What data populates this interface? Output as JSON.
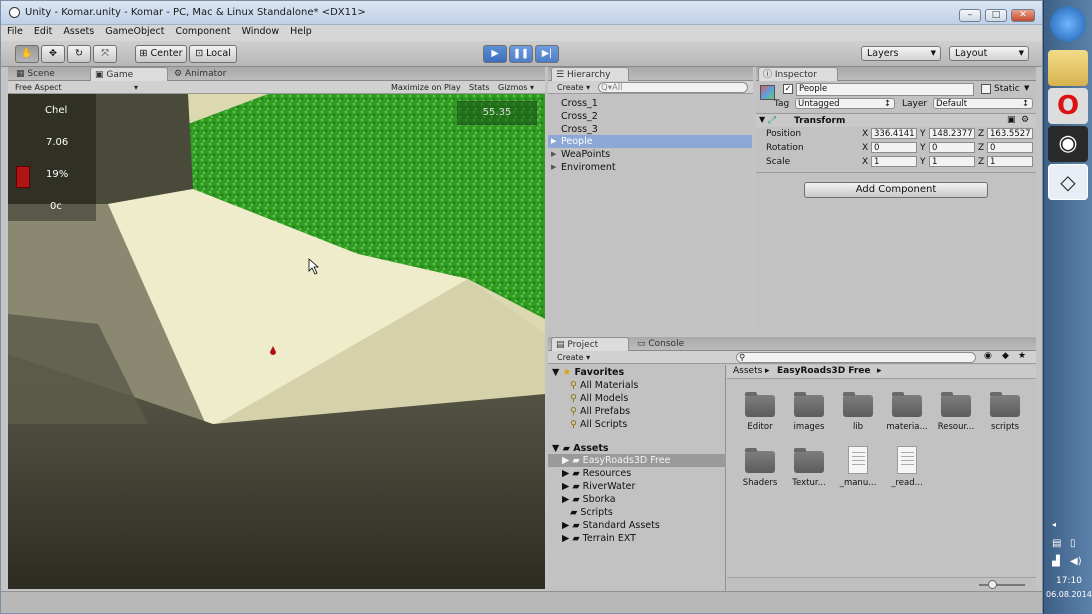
{
  "window": {
    "title": "Unity - Komar.unity - Komar - PC, Mac & Linux Standalone* <DX11>"
  },
  "menu": [
    "File",
    "Edit",
    "Assets",
    "GameObject",
    "Component",
    "Window",
    "Help"
  ],
  "toolbar": {
    "center": "Center",
    "local": "Local",
    "layers": "Layers",
    "layout": "Layout"
  },
  "scene_tabs": {
    "scene": "Scene",
    "game": "Game",
    "animator": "Animator"
  },
  "game_bar": {
    "aspect": "Free Aspect",
    "maximize": "Maximize on Play",
    "stats": "Stats",
    "gizmos": "Gizmos"
  },
  "hud": {
    "name": "Chel",
    "value1": "7.06",
    "percent": "19%",
    "value2": "0c",
    "fps": "55.35"
  },
  "hierarchy": {
    "title": "Hierarchy",
    "create": "Create",
    "search_placeholder": "Q▾All",
    "items": [
      {
        "label": "Cross_1",
        "arrow": ""
      },
      {
        "label": "Cross_2",
        "arrow": ""
      },
      {
        "label": "Cross_3",
        "arrow": ""
      },
      {
        "label": "People",
        "arrow": "▶"
      },
      {
        "label": "WeaPoints",
        "arrow": "▶"
      },
      {
        "label": "Enviroment",
        "arrow": "▶"
      }
    ]
  },
  "inspector": {
    "title": "Inspector",
    "name": "People",
    "static": "Static",
    "tag_label": "Tag",
    "tag": "Untagged",
    "layer_label": "Layer",
    "layer": "Default",
    "component": "Transform",
    "position_label": "Position",
    "rotation_label": "Rotation",
    "scale_label": "Scale",
    "position": [
      "336.4141",
      "148.2377",
      "163.5527"
    ],
    "rotation": [
      "0",
      "0",
      "0"
    ],
    "scale": [
      "1",
      "1",
      "1"
    ],
    "axes": [
      "X",
      "Y",
      "Z"
    ],
    "add_component": "Add Component"
  },
  "project": {
    "title": "Project",
    "console": "Console",
    "create": "Create",
    "favorites": "Favorites",
    "favorite_items": [
      "All Materials",
      "All Models",
      "All Prefabs",
      "All Scripts"
    ],
    "assets": "Assets",
    "asset_folders": [
      "EasyRoads3D Free",
      "Resources",
      "RiverWater",
      "Sborka",
      "Scripts",
      "Standard Assets",
      "Terrain EXT"
    ],
    "breadcrumb": [
      "Assets",
      "EasyRoads3D Free"
    ],
    "grid": [
      {
        "label": "Editor",
        "kind": "folder"
      },
      {
        "label": "images",
        "kind": "folder"
      },
      {
        "label": "lib",
        "kind": "folder"
      },
      {
        "label": "materia...",
        "kind": "folder"
      },
      {
        "label": "Resour...",
        "kind": "folder"
      },
      {
        "label": "scripts",
        "kind": "folder"
      },
      {
        "label": "Shaders",
        "kind": "folder"
      },
      {
        "label": "Textur...",
        "kind": "folder"
      },
      {
        "label": "_manu...",
        "kind": "doc"
      },
      {
        "label": "_read...",
        "kind": "doc"
      }
    ]
  },
  "clock": {
    "time": "17:10",
    "date": "06.08.2014"
  },
  "colors": {
    "selection": "#8da8d6",
    "play_active": "#3a6fbd",
    "grass": "#3aa82a"
  }
}
